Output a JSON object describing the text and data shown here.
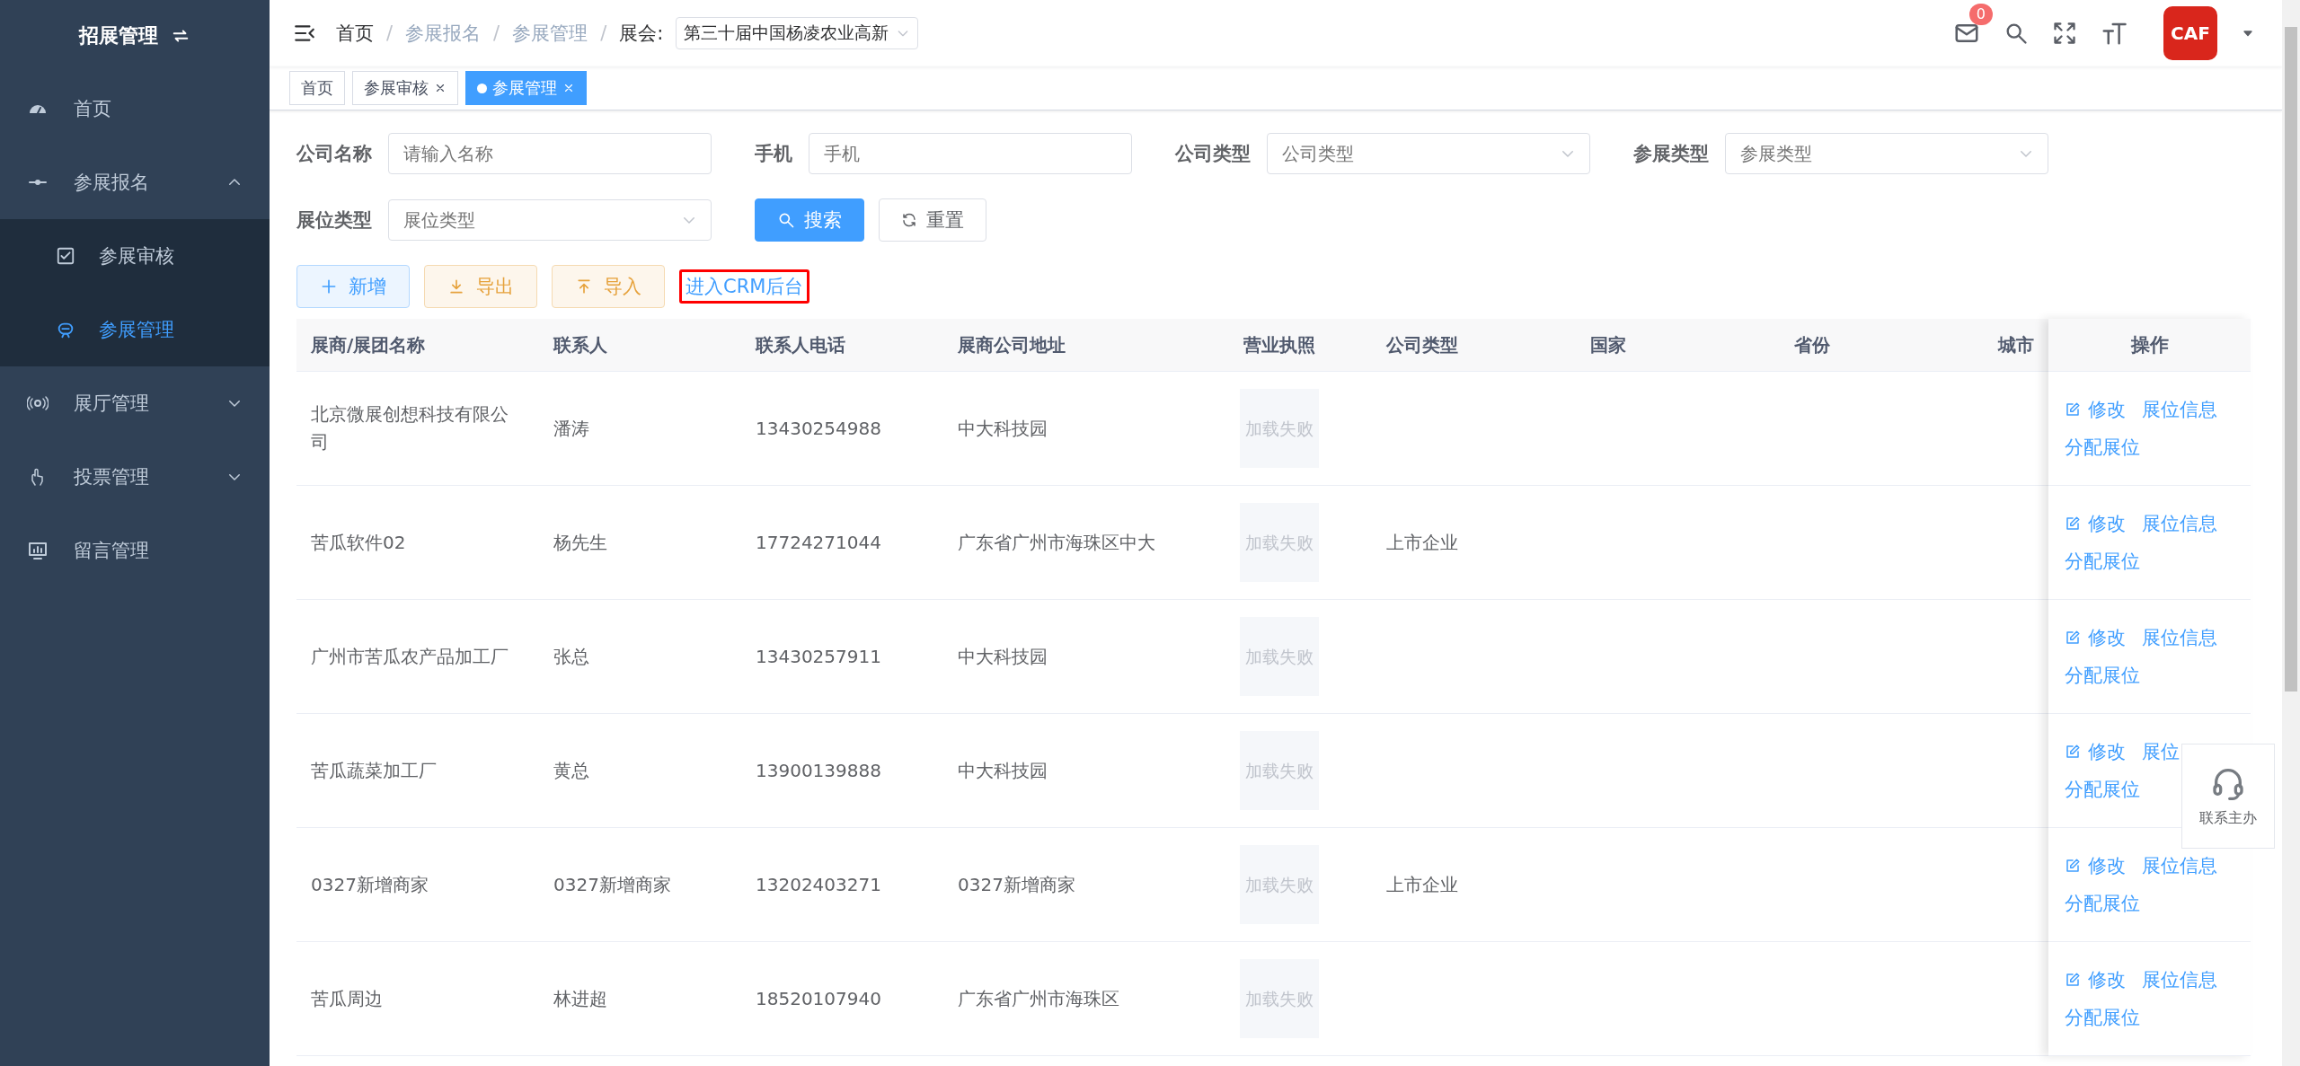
{
  "sidebar": {
    "title": "招展管理",
    "items": [
      {
        "label": "首页",
        "kind": "link"
      },
      {
        "label": "参展报名",
        "kind": "submenu",
        "expanded": true,
        "children": [
          {
            "label": "参展审核",
            "selected": false
          },
          {
            "label": "参展管理",
            "selected": true
          }
        ]
      },
      {
        "label": "展厅管理",
        "kind": "submenu",
        "expanded": false
      },
      {
        "label": "投票管理",
        "kind": "submenu",
        "expanded": false
      },
      {
        "label": "留言管理",
        "kind": "link"
      }
    ]
  },
  "header": {
    "breadcrumbs": [
      "首页",
      "参展报名",
      "参展管理"
    ],
    "separators": [
      "/",
      "/",
      "/"
    ],
    "expo_label": "展会:",
    "expo_value": "第三十届中国杨凌农业高新",
    "message_count": "0",
    "logo": "CAF"
  },
  "tags": [
    {
      "label": "首页",
      "selected": false,
      "closable": false
    },
    {
      "label": "参展审核",
      "selected": false,
      "closable": true
    },
    {
      "label": "参展管理",
      "selected": true,
      "closable": true
    }
  ],
  "filters": [
    {
      "label": "公司名称",
      "kind": "input",
      "placeholder": "请输入名称"
    },
    {
      "label": "手机",
      "kind": "input",
      "placeholder": "手机"
    },
    {
      "label": "公司类型",
      "kind": "select",
      "placeholder": "公司类型"
    },
    {
      "label": "参展类型",
      "kind": "select",
      "placeholder": "参展类型"
    },
    {
      "label": "展位类型",
      "kind": "select",
      "placeholder": "展位类型"
    }
  ],
  "search_button": "搜索",
  "reset_button": "重置",
  "toolbar": [
    {
      "label": "新增",
      "kind": "add"
    },
    {
      "label": "导出",
      "kind": "export"
    },
    {
      "label": "导入",
      "kind": "import"
    },
    {
      "label": "进入CRM后台",
      "kind": "link"
    }
  ],
  "table": {
    "columns": [
      "展商/展团名称",
      "联系人",
      "联系人电话",
      "展商公司地址",
      "营业执照",
      "公司类型",
      "国家",
      "省份",
      "城市"
    ],
    "action_column": "操作",
    "rows": [
      {
        "cells": [
          "北京微展创想科技有限公司",
          "潘涛",
          "13430254988",
          "中大科技园",
          "加载失败",
          "",
          "",
          "",
          ""
        ],
        "actions": [
          "修改",
          "展位信息",
          "分配展位"
        ]
      },
      {
        "cells": [
          "苦瓜软件02",
          "杨先生",
          "17724271044",
          "广东省广州市海珠区中大",
          "加载失败",
          "上市企业",
          "",
          "",
          ""
        ],
        "actions": [
          "修改",
          "展位信息",
          "分配展位"
        ]
      },
      {
        "cells": [
          "广州市苦瓜农产品加工厂",
          "张总",
          "13430257911",
          "中大科技园",
          "加载失败",
          "",
          "",
          "",
          ""
        ],
        "actions": [
          "修改",
          "展位信息",
          "分配展位"
        ]
      },
      {
        "cells": [
          "苦瓜蔬菜加工厂",
          "黄总",
          "13900139888",
          "中大科技园",
          "加载失败",
          "",
          "",
          "",
          ""
        ],
        "actions": [
          "修改",
          "展位",
          "分配展位"
        ]
      },
      {
        "cells": [
          "0327新增商家",
          "0327新增商家",
          "13202403271",
          "0327新增商家",
          "加载失败",
          "上市企业",
          "",
          "",
          ""
        ],
        "actions": [
          "修改",
          "展位信息",
          "分配展位"
        ]
      },
      {
        "cells": [
          "苦瓜周边",
          "林进超",
          "18520107940",
          "广东省广州市海珠区",
          "加载失败",
          "",
          "",
          "",
          ""
        ],
        "actions": [
          "修改",
          "展位信息",
          "分配展位"
        ]
      }
    ]
  },
  "contact_widget": {
    "label": "联系主办"
  }
}
